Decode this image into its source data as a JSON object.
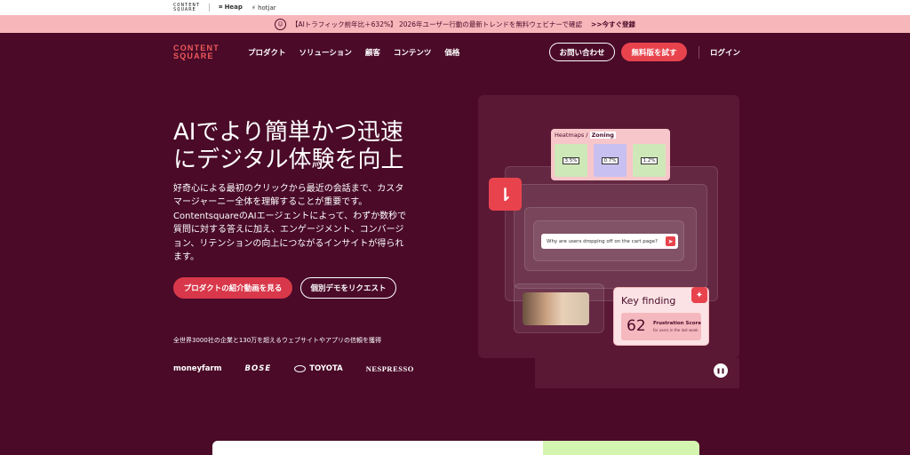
{
  "topbar": {
    "brand_line1": "CONTENT",
    "brand_line2": "SQUARE",
    "heap": "Heap",
    "hotjar": "hotjar"
  },
  "promo": {
    "icon": "chat-bubble-icon",
    "text": "【AIトラフィック前年比＋632%】 2026年ユーザー行動の最新トレンドを無料ウェビナーで確認",
    "cta": ">>今すぐ登録"
  },
  "nav": {
    "logo_line1": "CONTENT",
    "logo_line2": "SQUARE",
    "items": [
      "プロダクト",
      "ソリューション",
      "顧客",
      "コンテンツ",
      "価格"
    ],
    "contact": "お問い合わせ",
    "trial": "無料版を試す",
    "login": "ログイン"
  },
  "hero": {
    "title_line1": "AIでより簡単かつ迅速",
    "title_line2": "にデジタル体験を向上",
    "description": "好奇心による最初のクリックから最近の会話まで、カスタマージャーニー全体を理解することが重要です。ContentsquareのAIエージェントによって、わずか数秒で質問に対する答えに加え、エンゲージメント、コンバージョン、リテンションの向上につながるインサイトが得られます。",
    "cta_video": "プロダクトの紹介動画を見る",
    "cta_demo": "個別デモをリクエスト",
    "trust": "全世界3000社の企業と130万を超えるウェブサイトやアプリの信頼を獲得",
    "logos": [
      "moneyfarm",
      "BOSE",
      "TOYOTA",
      "NESPRESSO"
    ]
  },
  "visual": {
    "heatmaps_label": "Heatmaps /",
    "zoning_label": "Zoning",
    "cells": [
      "3.5%",
      "0.7%",
      "1.2%"
    ],
    "query": "Why are users dropping off on the cart page?",
    "key_finding": "Key finding",
    "score": "62",
    "score_label": "Frustration Score",
    "score_sub": "for users in the last week",
    "colors": {
      "accent": "#e8434d",
      "bg": "#4a0a28"
    }
  }
}
